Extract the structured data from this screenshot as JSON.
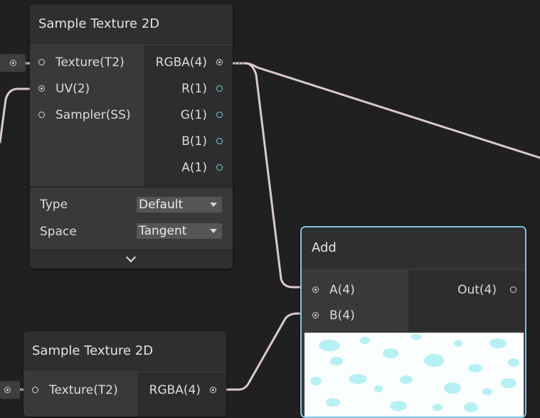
{
  "nodes": {
    "sample_texture_top": {
      "title": "Sample Texture 2D",
      "inputs": [
        {
          "label": "Texture(T2)"
        },
        {
          "label": "UV(2)"
        },
        {
          "label": "Sampler(SS)"
        }
      ],
      "outputs": [
        {
          "label": "RGBA(4)"
        },
        {
          "label": "R(1)"
        },
        {
          "label": "G(1)"
        },
        {
          "label": "B(1)"
        },
        {
          "label": "A(1)"
        }
      ],
      "properties": {
        "type_label": "Type",
        "type_value": "Default",
        "space_label": "Space",
        "space_value": "Tangent"
      }
    },
    "add": {
      "title": "Add",
      "inputs": [
        {
          "label": "A(4)"
        },
        {
          "label": "B(4)"
        }
      ],
      "outputs": [
        {
          "label": "Out(4)"
        }
      ]
    },
    "sample_texture_bottom": {
      "title": "Sample Texture 2D",
      "inputs": [
        {
          "label": "Texture(T2)"
        }
      ],
      "outputs": [
        {
          "label": "RGBA(4)"
        }
      ]
    }
  },
  "colors": {
    "background": "#202020",
    "node_body": "#393939",
    "node_header": "#2f2f2f",
    "wire": "#d9c9d4",
    "selection_outline": "#7fc3dc",
    "vector1_port": "#7ed0e6",
    "preview_tint": "#b6f0f4"
  },
  "icons": {
    "expand": "chevron-down-icon",
    "dropdown": "caret-down-icon",
    "port": "port-circle-icon"
  }
}
